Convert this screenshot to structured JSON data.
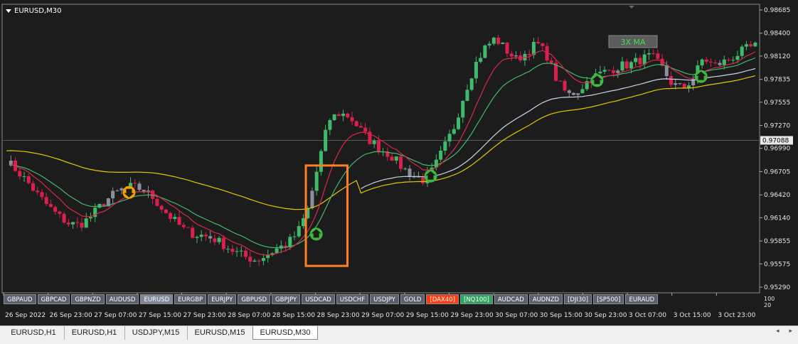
{
  "window": {
    "title": "EURUSD,M30"
  },
  "colors": {
    "background": "#1c1c1c",
    "bull_candle": "#3fba6a",
    "bear_candle": "#dc1f4c",
    "neutral_candle": "#8c8ea0",
    "ma_fast": "#d9284a",
    "ma_mid": "#3fba6a",
    "ma_slow": "#c9d6ea",
    "ma_yellow": "#e6c800",
    "highlight_box": "#ff7f27",
    "arrow_up": "#3fba3f",
    "arrow_down": "#f2a100"
  },
  "chart_data": {
    "type": "candlestick",
    "symbol": "EURUSD",
    "timeframe": "M30",
    "ylim": [
      0.9529,
      0.98685
    ],
    "y_ticks": [
      "0.98685",
      "0.98400",
      "0.98120",
      "0.97835",
      "0.97555",
      "0.97270",
      "0.96990",
      "0.96705",
      "0.96420",
      "0.96140",
      "0.95855",
      "0.95575",
      "0.95290"
    ],
    "current_price": "0.97088",
    "x_ticks": [
      "26 Sep 2022",
      "26 Sep 23:00",
      "27 Sep 07:00",
      "27 Sep 15:00",
      "27 Sep 23:00",
      "28 Sep 07:00",
      "28 Sep 15:00",
      "28 Sep 23:00",
      "29 Sep 07:00",
      "29 Sep 15:00",
      "29 Sep 23:00",
      "30 Sep 07:00",
      "30 Sep 15:00",
      "30 Sep 23:00",
      "3 Oct 07:00",
      "3 Oct 15:00",
      "3 Oct 23:00"
    ],
    "scale_label": "100\n20",
    "indicator_label": "3X MA",
    "close_path": [
      0.9684,
      0.9672,
      0.9658,
      0.9642,
      0.9628,
      0.9616,
      0.9607,
      0.9605,
      0.9614,
      0.9628,
      0.964,
      0.9648,
      0.9652,
      0.9649,
      0.964,
      0.9625,
      0.9612,
      0.96,
      0.9594,
      0.9592,
      0.9588,
      0.958,
      0.9572,
      0.9566,
      0.9562,
      0.9568,
      0.9576,
      0.9582,
      0.9596,
      0.9625,
      0.968,
      0.9734,
      0.9742,
      0.9738,
      0.9722,
      0.9708,
      0.9698,
      0.969,
      0.9676,
      0.9666,
      0.966,
      0.9672,
      0.9698,
      0.9724,
      0.9765,
      0.98,
      0.9822,
      0.9834,
      0.982,
      0.9808,
      0.9816,
      0.9828,
      0.9812,
      0.978,
      0.9764,
      0.977,
      0.9783,
      0.979,
      0.9795,
      0.98,
      0.9802,
      0.9808,
      0.9812,
      0.9798,
      0.9778,
      0.9772,
      0.9784,
      0.981,
      0.98,
      0.9805,
      0.9812,
      0.982,
      0.9824
    ],
    "arrows": [
      {
        "type": "down",
        "time_index": 12,
        "price": 0.9645
      },
      {
        "type": "up",
        "time_index": 30,
        "price": 0.9594
      },
      {
        "type": "up",
        "time_index": 41,
        "price": 0.9665
      },
      {
        "type": "up",
        "time_index": 57,
        "price": 0.9782
      },
      {
        "type": "up",
        "time_index": 67,
        "price": 0.9787
      }
    ],
    "highlight_box": {
      "time_start": 29,
      "time_end": 33,
      "price_low": 0.9555,
      "price_high": 0.9678
    }
  },
  "symbol_bar": [
    {
      "label": "GBPAUD",
      "style": "normal"
    },
    {
      "label": "GBPCAD",
      "style": "normal"
    },
    {
      "label": "GBPNZD",
      "style": "normal"
    },
    {
      "label": "AUDUSD",
      "style": "normal"
    },
    {
      "label": "EURUSD",
      "style": "active"
    },
    {
      "label": "EURGBP",
      "style": "normal"
    },
    {
      "label": "EURJPY",
      "style": "normal"
    },
    {
      "label": "GBPUSD",
      "style": "normal"
    },
    {
      "label": "GBPJPY",
      "style": "normal"
    },
    {
      "label": "USDCAD",
      "style": "normal"
    },
    {
      "label": "USDCHF",
      "style": "normal"
    },
    {
      "label": "USDJPY",
      "style": "normal"
    },
    {
      "label": "GOLD",
      "style": "normal"
    },
    {
      "label": "[DAX40]",
      "style": "red"
    },
    {
      "label": "[NQ100]",
      "style": "green"
    },
    {
      "label": "AUDCAD",
      "style": "normal"
    },
    {
      "label": "AUDNZD",
      "style": "normal"
    },
    {
      "label": "[DJI30]",
      "style": "normal"
    },
    {
      "label": "[SP500]",
      "style": "normal"
    },
    {
      "label": "EURAUD",
      "style": "normal"
    }
  ],
  "tabs": [
    {
      "label": "EURUSD,H1",
      "active": false
    },
    {
      "label": "EURUSD,H1",
      "active": false
    },
    {
      "label": "USDJPY,M15",
      "active": false
    },
    {
      "label": "EURUSD,M15",
      "active": false
    },
    {
      "label": "EURUSD,M30",
      "active": true
    }
  ]
}
